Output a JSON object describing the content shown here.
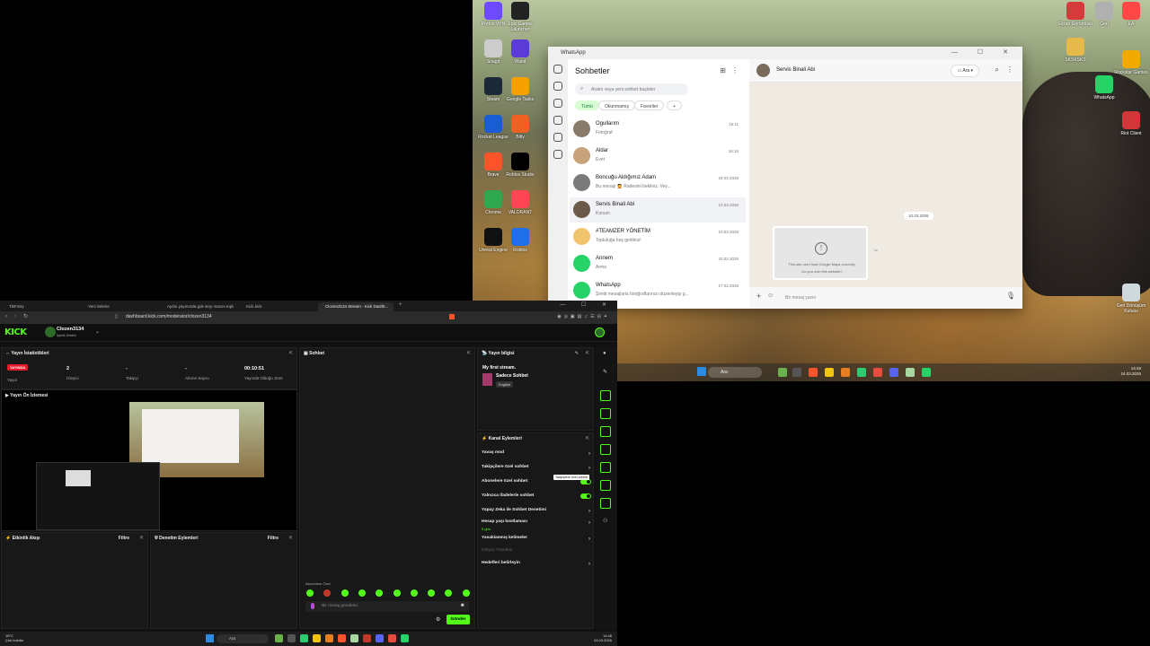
{
  "desktop": {
    "icons": [
      {
        "label": "Proton VPN",
        "color": "#6d4aff"
      },
      {
        "label": "Epic Games Launcher",
        "color": "#222"
      },
      {
        "label": "Snagit",
        "color": "#ccc"
      },
      {
        "label": "Wand",
        "color": "#5b3bd6"
      },
      {
        "label": "Steam",
        "color": "#1b2838"
      },
      {
        "label": "Google Tasks",
        "color": "#f7a100"
      },
      {
        "label": "Rocket League",
        "color": "#1a5cd6"
      },
      {
        "label": "Bitly",
        "color": "#ee6123"
      },
      {
        "label": "Brave",
        "color": "#fb542b"
      },
      {
        "label": "Roblox Studio",
        "color": "#000"
      },
      {
        "label": "Chrome",
        "color": "#2fa84f"
      },
      {
        "label": "VALORANT",
        "color": "#ff4655"
      },
      {
        "label": "Unreal Engine",
        "color": "#111"
      },
      {
        "label": "Roblox",
        "color": "#1e6fe8"
      }
    ],
    "right_icons": [
      {
        "label": "Ekran Görüntüsü",
        "color": "#d63b3b"
      },
      {
        "label": "Geri",
        "color": "#b0b0b0"
      },
      {
        "label": "EA",
        "color": "#ff4747"
      },
      {
        "label": "SKSKSKS",
        "color": "#e5b94a"
      },
      {
        "label": "Rockstar Games",
        "color": "#f2a900"
      },
      {
        "label": "WhatsApp",
        "color": "#25d366"
      },
      {
        "label": "Riot Client",
        "color": "#d13639"
      },
      {
        "label": "Geri Dönüşüm Kutusu",
        "color": "#cfd8dc"
      }
    ],
    "taskbar": {
      "search": "Ara",
      "time": "14:46",
      "date": "24.03.2026"
    }
  },
  "whatsapp": {
    "window_title": "WhatsApp",
    "list_title": "Sohbetler",
    "search_placeholder": "Aratın veya yeni sohbet başlatın",
    "filters": [
      "Tümü",
      "Okunmamış",
      "Favoriler",
      "+"
    ],
    "chats": [
      {
        "name": "Ogullarım",
        "message": "Fotoğraf",
        "time": "16:11",
        "color": "#8a7a6a"
      },
      {
        "name": "Aldar",
        "message": "Evet",
        "time": "16:18",
        "color": "#c7a27a"
      },
      {
        "name": "Boncuğu Aldığımız Adam",
        "message": "Bu mesajı 🤦 Radesini bekliniz. Vey...",
        "time": "16.03.2026",
        "color": "#7a7a7a"
      },
      {
        "name": "Servis Binali Abi",
        "message": "Konum",
        "time": "10.03.2026",
        "color": "#6b5a4a"
      },
      {
        "name": "#TEAMZER YÖNETİM",
        "message": "Topluluğa hoş geldiniz!",
        "time": "10.03.2026",
        "color": "#f0c36d"
      },
      {
        "name": "Annem",
        "message": "Arma",
        "time": "22.02.2026",
        "color": "#25d366"
      },
      {
        "name": "WhatsApp",
        "message": "Şimdi mesajlarla fotoğraflarınızı düzenleyip g...",
        "time": "17.02.2026",
        "color": "#25d366"
      }
    ],
    "active_chat": "Servis Binali Abi",
    "call_label": "Ara",
    "date_badge": "10.03.2026",
    "map_message": "This site can't load Google Maps correctly.",
    "map_question": "Do you own this website?",
    "input_placeholder": "Bir mesaj yazın"
  },
  "browser": {
    "tabs": [
      "TikFinity",
      "Yeni Sekme",
      "Aydın yayınında gok stoy maces topla...",
      "Kick.kick",
      "Clozen3134 Stream - Kick Dashb..."
    ],
    "url": "dashboard.kick.com/moderator/clozen3134"
  },
  "kick": {
    "logo": "KICK",
    "user": "Clozen3134",
    "role": "İçerik Üretici",
    "stats_title": "Yayın İstatistikleri",
    "live_badge": "YAYINDA",
    "stats": [
      {
        "value": "",
        "label": "Yayın"
      },
      {
        "value": "2",
        "label": "İzleyici"
      },
      {
        "value": "-",
        "label": "Takipçi"
      },
      {
        "value": "-",
        "label": "Abone Sayısı"
      },
      {
        "value": "00:10:51",
        "label": "Yayında Olduğu Süre"
      }
    ],
    "preview_title": "Yayın Ön İzlemesi",
    "chat_title": "Sohbet",
    "info_title": "Yayın bilgisi",
    "stream_title": "My first stream.",
    "category": "Sadece Sohbet",
    "language": "English",
    "actions_title": "Kanal Eylemleri",
    "actions": [
      {
        "label": "Yavaş mod",
        "type": "chevron"
      },
      {
        "label": "Takipçilere özel sohbet",
        "type": "chevron"
      },
      {
        "label": "Abonelere özel sohbet",
        "type": "toggle"
      },
      {
        "label": "Yalnızca ifadelerle sohbet",
        "type": "toggle"
      },
      {
        "label": "Yapay Zeka ile Sohbet Denetimi",
        "type": "chevron"
      },
      {
        "label": "Hesap yaşı kısıtlaması",
        "type": "chevron"
      },
      {
        "label": "Yasaklanmış kelimeler",
        "type": "chevron"
      },
      {
        "label": "İzleyici Yönetimi",
        "type": "none"
      },
      {
        "label": "Hedefleri belirleyin",
        "type": "chevron"
      }
    ],
    "account_age_value": "5 gün",
    "tooltip": "Takipçilere özel sohbet",
    "activity_title": "Etkinlik Akışı",
    "filter_label": "Filtre",
    "moderation_title": "Denetim Eylemleri",
    "emote_title": "Abonelere Özel",
    "chat_placeholder": "Bir mesaj gönderin",
    "send_label": "Gönder"
  },
  "bottom_taskbar": {
    "search": "Ara",
    "weather_temp": "18°C",
    "weather_desc": "Çok bulutlu",
    "time": "14:46",
    "date": "24.03.2026"
  }
}
